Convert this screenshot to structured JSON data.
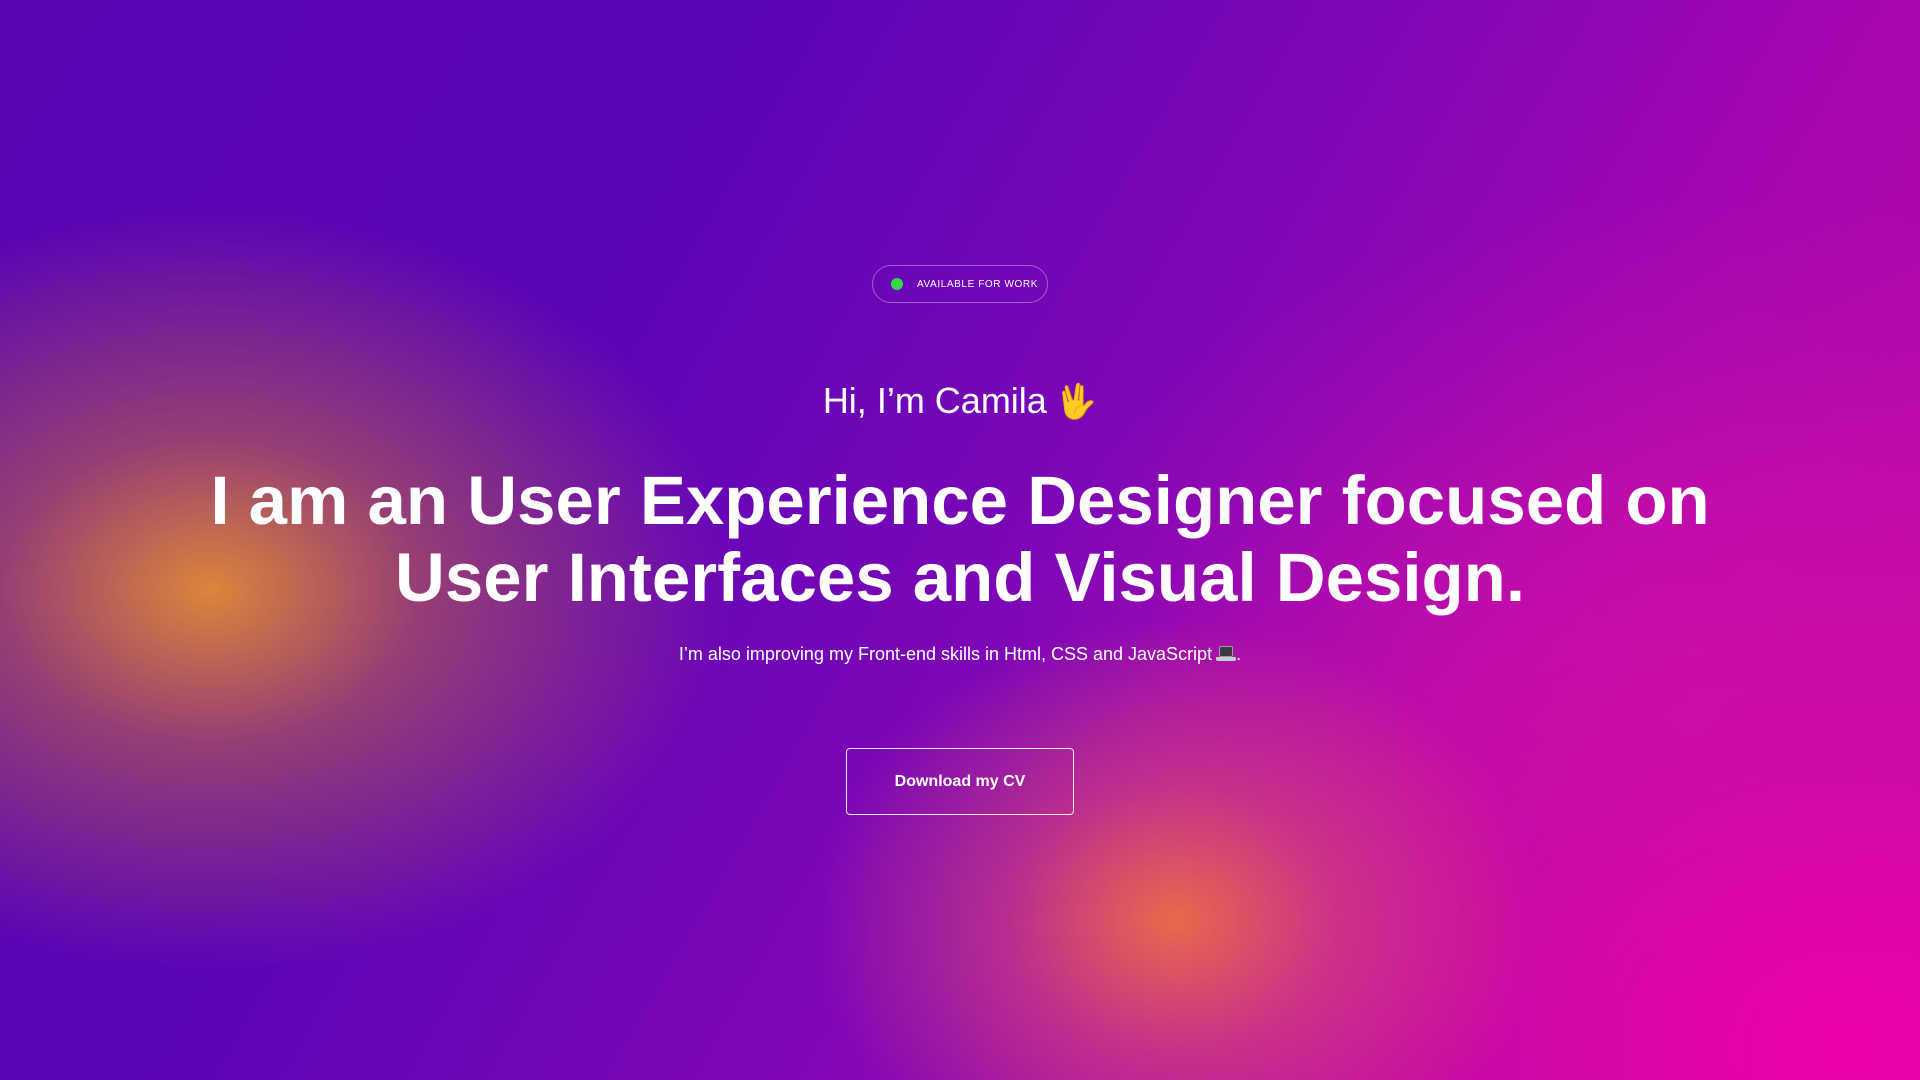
{
  "badge": {
    "label": "AVAILABLE FOR WORK",
    "status_color": "#35d84a"
  },
  "greeting": {
    "text": "Hi, I’m Camila",
    "emoji": "🖖",
    "emoji_name": "vulcan-salute-icon"
  },
  "headline": {
    "text": "I am an User Experience Designer focused on User Interfaces and Visual Design."
  },
  "subline": {
    "text": "I’m also improving my Front-end skills in Html, CSS and JavaScript",
    "icon": "laptop-icon",
    "suffix": "."
  },
  "cta": {
    "label": "Download my CV"
  },
  "theme": {
    "gradient_colors": [
      "#5a05b4",
      "#a806b0",
      "#f000aa",
      "#e28c34"
    ]
  }
}
